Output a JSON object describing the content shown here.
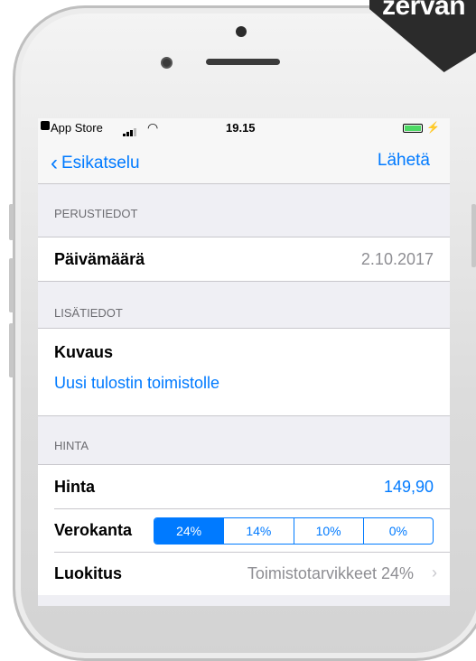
{
  "brand": {
    "text": "zervan"
  },
  "status_bar": {
    "back_app": "App Store",
    "time": "19.15"
  },
  "nav": {
    "back_label": "Esikatselu",
    "action_label": "Lähetä"
  },
  "sections": {
    "basic": {
      "header": "PERUSTIEDOT",
      "date_label": "Päivämäärä",
      "date_value": "2.10.2017"
    },
    "extra": {
      "header": "LISÄTIEDOT",
      "description_label": "Kuvaus",
      "description_value": "Uusi tulostin toimistolle"
    },
    "price": {
      "header": "HINTA",
      "price_label": "Hinta",
      "price_value": "149,90",
      "vat_label": "Verokanta",
      "vat_options": [
        "24%",
        "14%",
        "10%",
        "0%"
      ],
      "vat_selected": "24%",
      "category_label": "Luokitus",
      "category_value": "Toimistotarvikkeet 24%"
    }
  },
  "colors": {
    "accent": "#007aff",
    "background": "#efeff4"
  }
}
